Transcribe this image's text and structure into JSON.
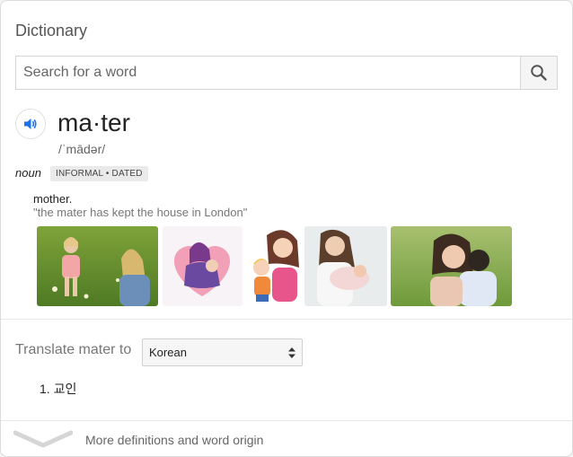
{
  "header": {
    "title": "Dictionary"
  },
  "search": {
    "placeholder": "Search for a word",
    "button_icon": "search-icon"
  },
  "entry": {
    "word": "ma·ter",
    "phonetic": "/ˈmādər/",
    "part_of_speech": "noun",
    "usage_label": "INFORMAL • DATED",
    "definition": "mother.",
    "example": "\"the mater has kept the house in London\""
  },
  "images": [
    {
      "description": "photo-mother-daughter-meadow"
    },
    {
      "description": "illustration-mother-hug"
    },
    {
      "description": "illustration-cartoon-mother-child"
    },
    {
      "description": "photo-mother-holding-baby"
    },
    {
      "description": "photo-mother-hugging-son"
    }
  ],
  "translate": {
    "label": "Translate mater to",
    "selected_language": "Korean",
    "results": [
      "1. 교인"
    ]
  },
  "footer": {
    "more_label": "More definitions and word origin"
  },
  "colors": {
    "accent": "#1a73e8",
    "muted": "#777777",
    "label_bg": "#eaeaea"
  }
}
